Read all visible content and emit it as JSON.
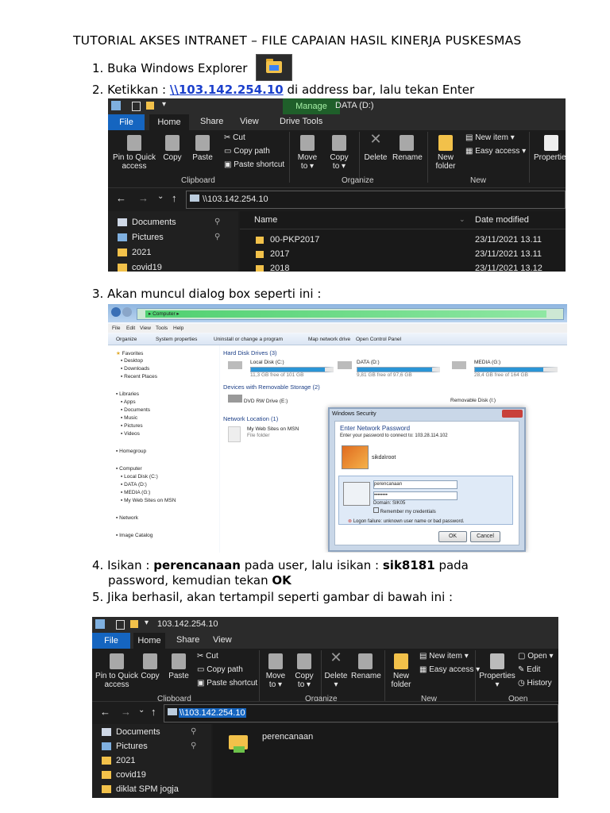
{
  "title": "TUTORIAL AKSES INTRANET  – FILE CAPAIAN HASIL KINERJA PUSKESMAS",
  "steps": {
    "s1": "1. Buka Windows Explorer",
    "s2_pre": "2. Ketikkan : ",
    "s2_link": "\\\\103.142.254.10",
    "s2_post": " di address bar, lalu tekan Enter",
    "s3": "3. Akan muncul dialog box seperti ini :",
    "s4_a": "4. Isikan : ",
    "s4_user": "perencanaan",
    "s4_b": " pada user, lalu isikan : ",
    "s4_pass": "sik8181",
    "s4_c": " pada",
    "s4_line2a": "password, kemudian tekan ",
    "s4_ok": "OK",
    "s5": "5. Jika berhasil, akan tertampil seperti gambar di bawah ini :"
  },
  "explorer1": {
    "manage": "Manage",
    "window_title": "DATA (D:)",
    "tabs": [
      "File",
      "Home",
      "Share",
      "View",
      "Drive Tools"
    ],
    "ribbon": {
      "pin": "Pin to Quick access",
      "copy": "Copy",
      "paste": "Paste",
      "cut": "Cut",
      "copy_path": "Copy path",
      "paste_shortcut": "Paste shortcut",
      "move_to": "Move to",
      "copy_to": "Copy to",
      "delete": "Delete",
      "rename": "Rename",
      "new_folder": "New folder",
      "new_item": "New item",
      "easy_access": "Easy access",
      "properties": "Properties"
    },
    "groups": [
      "Clipboard",
      "Organize",
      "New"
    ],
    "address": "\\\\103.142.254.10",
    "nav": [
      "Documents",
      "Pictures",
      "2021",
      "covid19"
    ],
    "col_name": "Name",
    "col_date": "Date modified",
    "rows": [
      {
        "name": "00-PKP2017",
        "date": "23/11/2021 13.11"
      },
      {
        "name": "2017",
        "date": "23/11/2021 13.11"
      },
      {
        "name": "2018",
        "date": "23/11/2021 13.12"
      }
    ]
  },
  "win7": {
    "breadcrumb": "Computer",
    "menu": [
      "File",
      "Edit",
      "View",
      "Tools",
      "Help"
    ],
    "toolbar": [
      "Organize",
      "System properties",
      "Uninstall or change a program",
      "Map network drive",
      "Open Control Panel"
    ],
    "side": [
      "Favorites",
      "Desktop",
      "Downloads",
      "Recent Places",
      "Libraries",
      "Apps",
      "Documents",
      "Music",
      "Pictures",
      "Videos",
      "Homegroup",
      "Computer",
      "Local Disk (C:)",
      "DATA (D:)",
      "MEDIA (G:)",
      "My Web Sites on MSN",
      "Network",
      "Image Catalog"
    ],
    "sec_hdd": "Hard Disk Drives (3)",
    "drives": [
      {
        "name": "Local Disk (C:)",
        "free": "11,3 GB free of 101 GB",
        "used_fraction": 0.89
      },
      {
        "name": "DATA (D:)",
        "free": "9,81 GB free of 97,6 GB",
        "used_fraction": 0.9
      },
      {
        "name": "MEDIA (G:)",
        "free": "28,4 GB free of 164 GB",
        "used_fraction": 0.83
      }
    ],
    "sec_removable": "Devices with Removable Storage (2)",
    "dvd": "DVD RW Drive (E:)",
    "removable": "Removable Disk (I:)",
    "sec_network": "Network Location (1)",
    "msn": "My Web Sites on MSN",
    "msn_sub": "File folder",
    "dialog": {
      "title": "Windows Security",
      "heading": "Enter Network Password",
      "sub": "Enter your password to connect to: 103.28.114.102",
      "saved_user": "sikda\\root",
      "user_value": "perencanaan",
      "password_mask": "••••••••",
      "domain": "Domain: SIK05",
      "remember": "Remember my credentials",
      "error": "Logon failure: unknown user name or bad password.",
      "ok": "OK",
      "cancel": "Cancel"
    }
  },
  "explorer2": {
    "window_title": "103.142.254.10",
    "tabs": [
      "File",
      "Home",
      "Share",
      "View"
    ],
    "ribbon": {
      "pin": "Pin to Quick access",
      "copy": "Copy",
      "paste": "Paste",
      "cut": "Cut",
      "copy_path": "Copy path",
      "paste_shortcut": "Paste shortcut",
      "move_to": "Move to",
      "copy_to": "Copy to",
      "delete": "Delete",
      "rename": "Rename",
      "new_folder": "New folder",
      "new_item": "New item",
      "easy_access": "Easy access",
      "properties": "Properties",
      "open": "Open",
      "edit": "Edit",
      "history": "History"
    },
    "groups": [
      "Clipboard",
      "Organize",
      "New",
      "Open"
    ],
    "address": "\\\\103.142.254.10",
    "nav": [
      "Documents",
      "Pictures",
      "2021",
      "covid19",
      "diklat SPM jogja"
    ],
    "folder": "perencanaan"
  }
}
